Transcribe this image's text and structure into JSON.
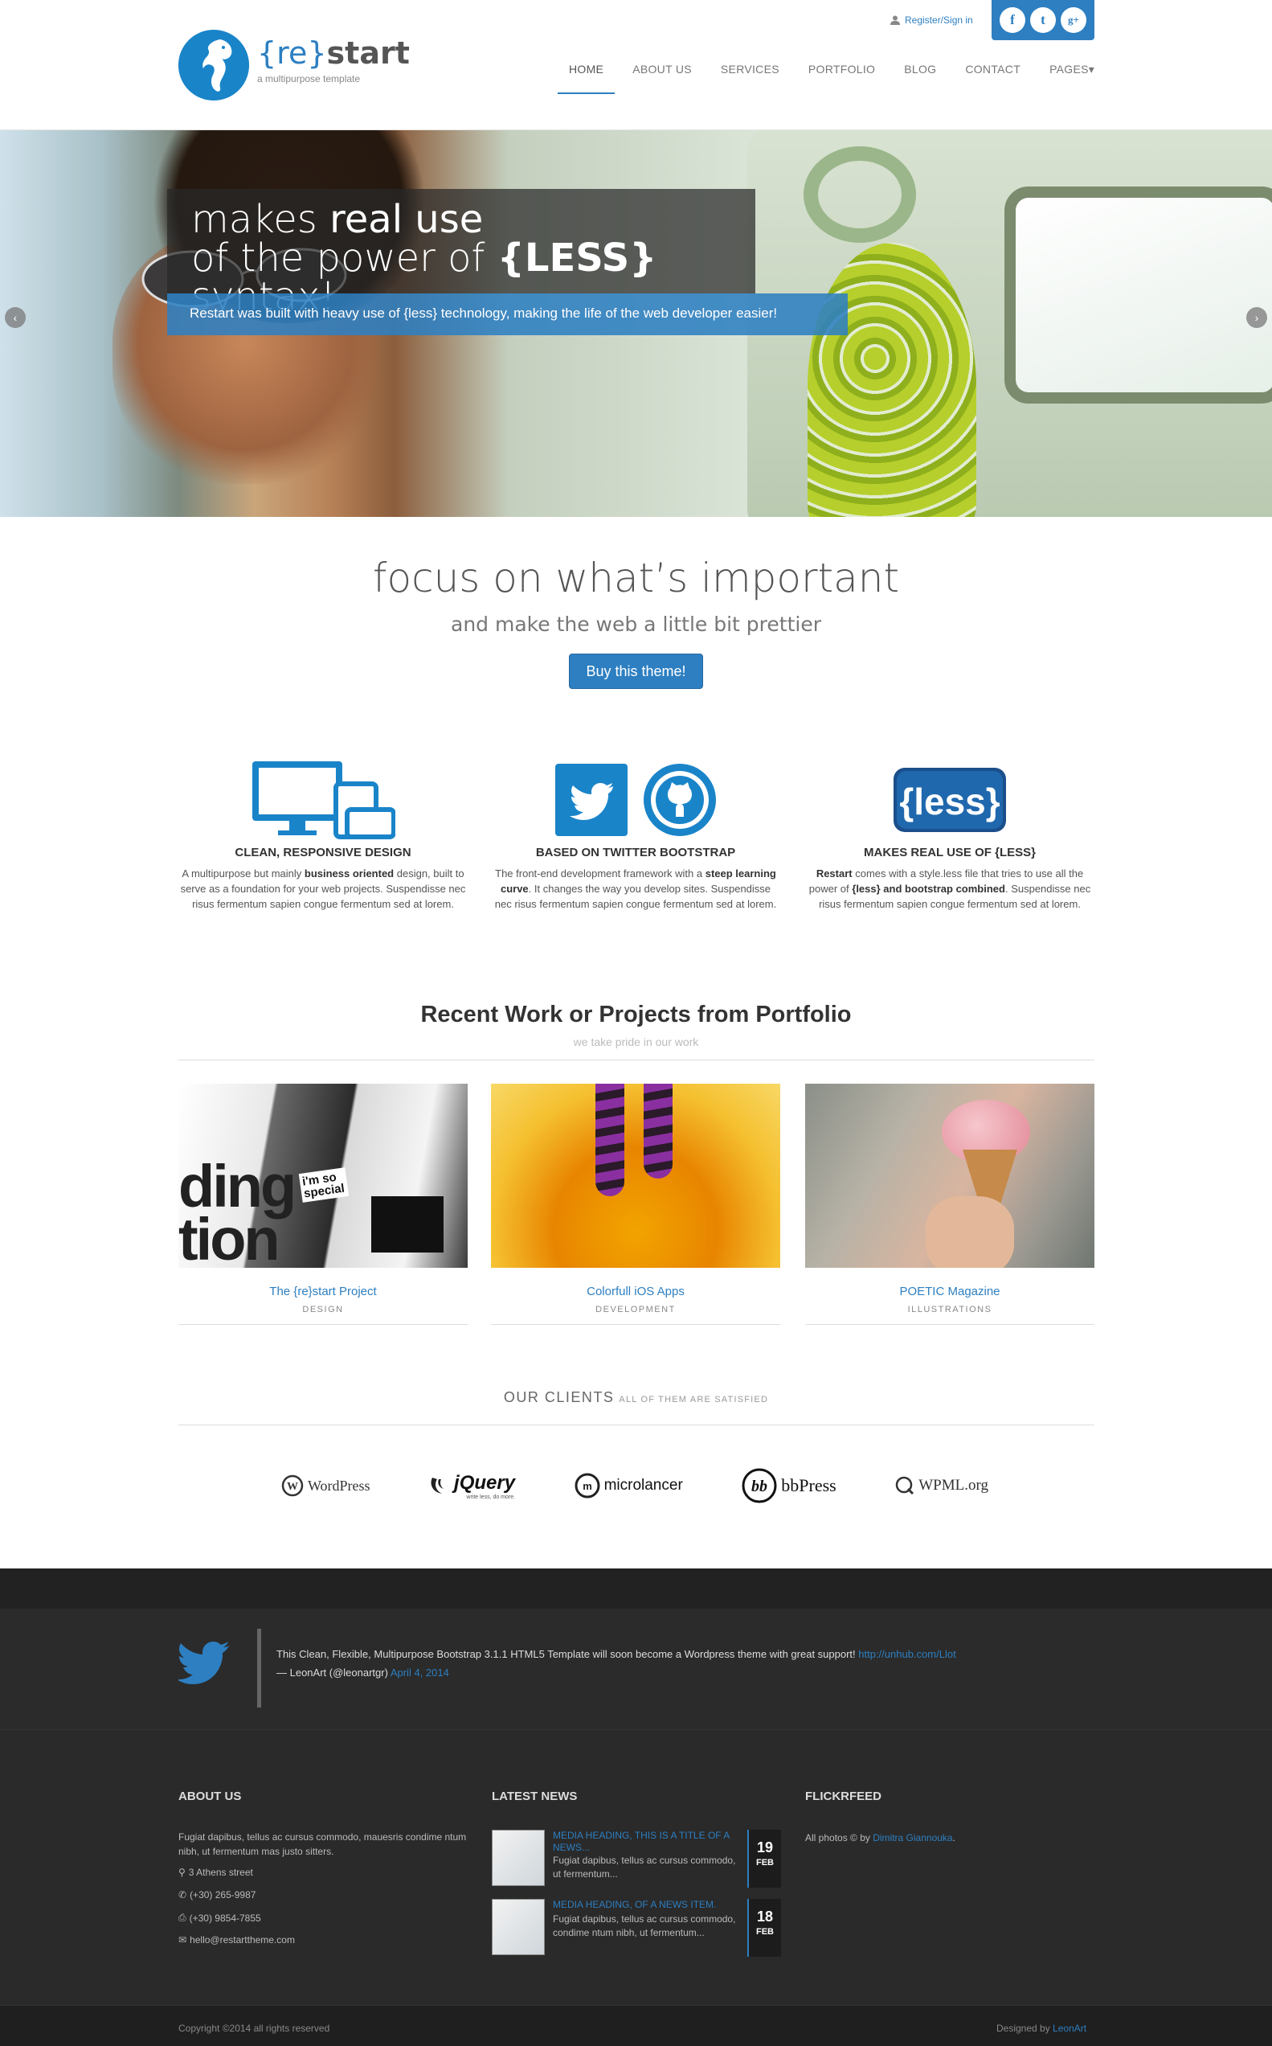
{
  "header": {
    "logo_brace_open": "{re}",
    "logo_word": "start",
    "logo_tagline": "a multipurpose template",
    "register_label": "Register/Sign in",
    "social": [
      "f",
      "t",
      "g+"
    ],
    "nav": [
      "HOME",
      "ABOUT US",
      "SERVICES",
      "PORTFOLIO",
      "BLOG",
      "CONTACT",
      "PAGES▾"
    ],
    "active_nav": "HOME"
  },
  "hero": {
    "line1_light": "makes ",
    "line1_bold": "real use",
    "line2_light": "of the power of ",
    "line2_bold": "{LESS}",
    "line2_end": " syntax!",
    "subtitle": "Restart was built with heavy use of {less} technology, making the life of the web developer easier!",
    "prev": "‹",
    "next": "›"
  },
  "intro": {
    "title": "focus on what’s important",
    "subtitle": "and make the web a little bit prettier",
    "button": "Buy this theme!"
  },
  "features": [
    {
      "title": "CLEAN, RESPONSIVE DESIGN",
      "text_a": "A multipurpose but mainly ",
      "text_b": "business oriented",
      "text_c": " design, built to serve as a foundation for your web projects. Suspendisse nec risus fermentum sapien congue fermentum sed at lorem."
    },
    {
      "title": "BASED ON TWITTER BOOTSTRAP",
      "text_a": "The front-end development framework with a ",
      "text_b": "steep learning curve",
      "text_c": ". It changes the way you develop sites. Suspendisse nec risus fermentum sapien congue fermentum sed at lorem."
    },
    {
      "title": "MAKES REAL USE OF {LESS}",
      "text_a": "Restart",
      "text_b": " comes with a style.less file that tries to use all the power of ",
      "text_c": "{less} and bootstrap combined",
      "text_d": ". Suspendisse nec risus fermentum sapien congue fermentum sed at lorem."
    }
  ],
  "less_logo": "{less}",
  "portfolio": {
    "title": "Recent Work or Projects from Portfolio",
    "subtitle": "we take pride in our work",
    "items": [
      {
        "title": "The {re}start Project",
        "category": "DESIGN",
        "img_text_1": "ding",
        "img_text_2": "tion",
        "img_text_3": "i'm so special"
      },
      {
        "title": "Colorfull iOS Apps",
        "category": "DEVELOPMENT"
      },
      {
        "title": "POETIC Magazine",
        "category": "ILLUSTRATIONS"
      }
    ]
  },
  "clients": {
    "title": "OUR CLIENTS",
    "subtitle": "ALL OF THEM ARE SATISFIED",
    "logos": [
      "WordPress",
      "jQuery",
      "microlancer",
      "bbPress",
      "WPML.org"
    ],
    "jquery_tag": "write less, do more."
  },
  "tweet": {
    "text": "This Clean, Flexible, Multipurpose Bootstrap 3.1.1 HTML5 Template will soon become a Wordpress theme with great support!",
    "link": "http://unhub.com/Llot",
    "author": "— LeonArt (@leonartgr)",
    "date": "April 4, 2014"
  },
  "footer": {
    "about_title": "ABOUT US",
    "about_text": "Fugiat dapibus, tellus ac cursus commodo, mauesris condime ntum nibh, ut fermentum mas justo sitters.",
    "address": "3 Athens street",
    "phone": "(+30) 265-9987",
    "fax": "(+30) 9854-7855",
    "email": "hello@restarttheme.com",
    "news_title": "LATEST NEWS",
    "news": [
      {
        "heading": "MEDIA HEADING, THIS IS A TITLE OF A NEWS...",
        "body": "Fugiat dapibus, tellus ac cursus commodo, ut fermentum...",
        "day": "19",
        "month": "FEB"
      },
      {
        "heading": "MEDIA HEADING, OF A NEWS ITEM.",
        "body": "Fugiat dapibus, tellus ac cursus commodo, condime ntum nibh, ut fermentum...",
        "day": "18",
        "month": "FEB"
      }
    ],
    "flickr_title": "FLICKRFEED",
    "flickr_text": "All photos © by ",
    "flickr_link": "Dimitra Giannouka",
    "copyright": "Copyright ©2014 all rights reserved",
    "designed_by": "Designed by ",
    "designer": "LeonArt"
  },
  "colors": {
    "accent": "#2d7fc1",
    "dark": "#2b2b2b"
  }
}
